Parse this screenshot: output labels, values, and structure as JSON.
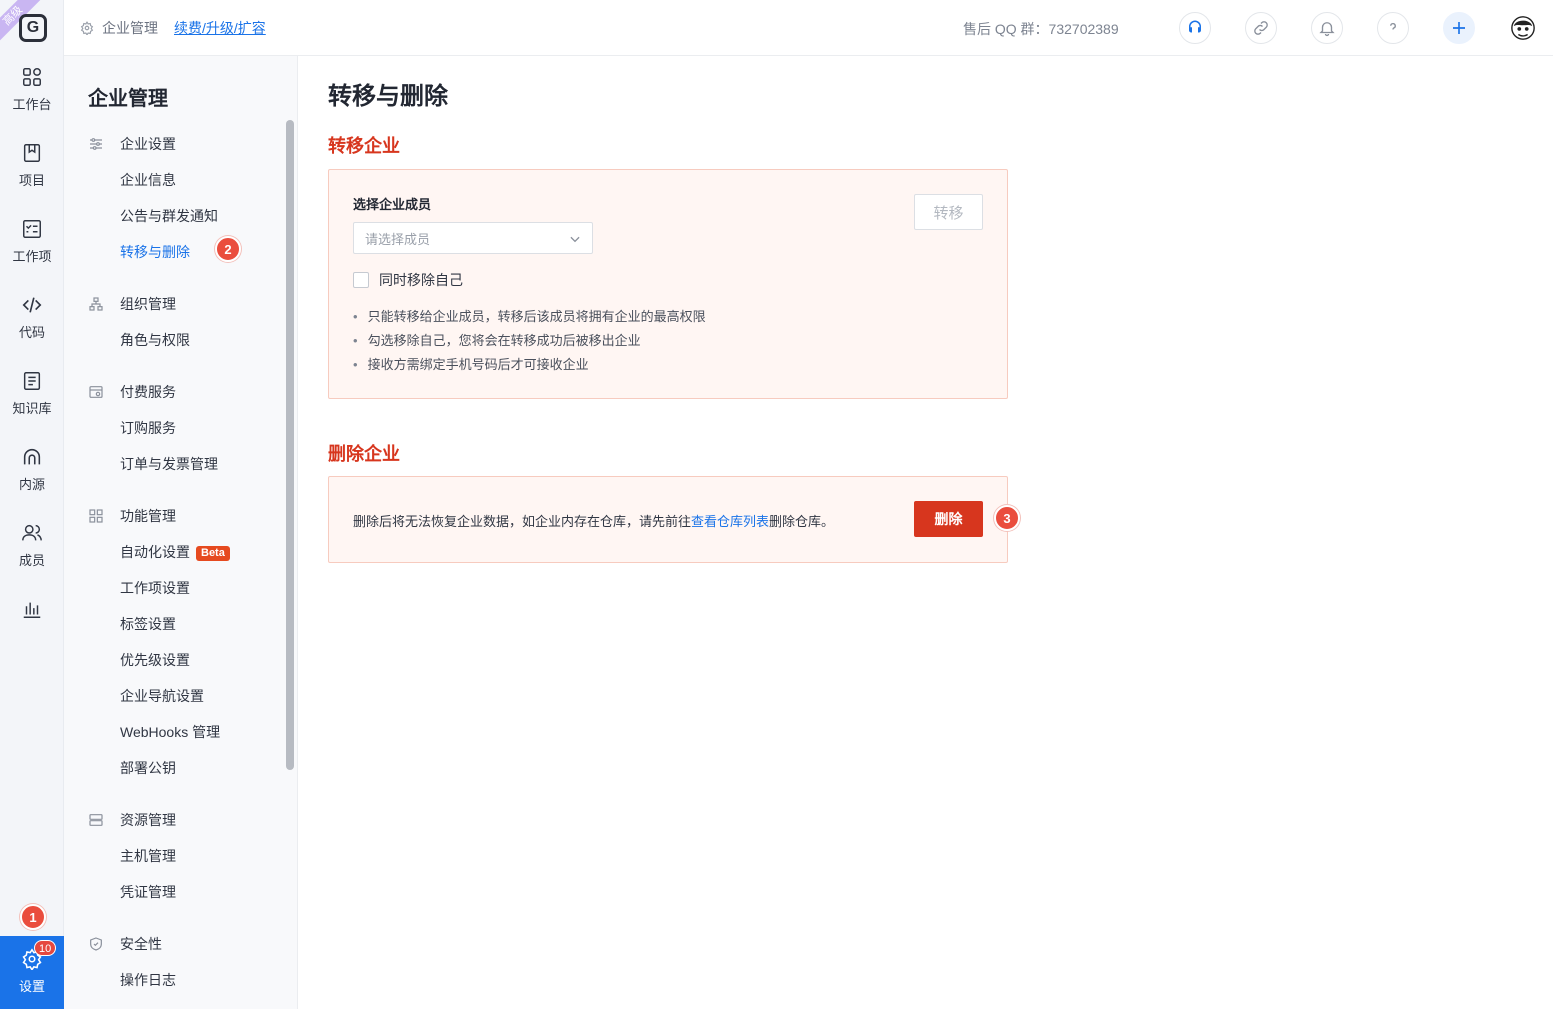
{
  "rail": {
    "ribbon": "高级",
    "logo": "G",
    "items": [
      {
        "label": "工作台",
        "icon": "grid-icon"
      },
      {
        "label": "项目",
        "icon": "book-icon"
      },
      {
        "label": "工作项",
        "icon": "checklist-icon"
      },
      {
        "label": "代码",
        "icon": "code-icon"
      },
      {
        "label": "知识库",
        "icon": "document-icon"
      },
      {
        "label": "内源",
        "icon": "source-icon"
      },
      {
        "label": "成员",
        "icon": "members-icon"
      },
      {
        "label": "",
        "icon": "bar-chart-icon"
      }
    ],
    "settings": {
      "label": "设置",
      "badge": "10"
    }
  },
  "steps": {
    "one": "1",
    "two": "2",
    "three": "3"
  },
  "header": {
    "breadcrumb": "企业管理",
    "renew_link": "续费/升级/扩容",
    "support": "售后 QQ 群：732702389"
  },
  "sidebar": {
    "title": "企业管理",
    "groups": [
      {
        "label": "企业设置",
        "items": [
          "企业信息",
          "公告与群发通知",
          "转移与删除"
        ]
      },
      {
        "label": "组织管理",
        "items": [
          "角色与权限"
        ]
      },
      {
        "label": "付费服务",
        "items": [
          "订购服务",
          "订单与发票管理"
        ]
      },
      {
        "label": "功能管理",
        "items": [
          "自动化设置",
          "工作项设置",
          "标签设置",
          "优先级设置",
          "企业导航设置",
          "WebHooks 管理",
          "部署公钥"
        ]
      },
      {
        "label": "资源管理",
        "items": [
          "主机管理",
          "凭证管理"
        ]
      },
      {
        "label": "安全性",
        "items": [
          "操作日志"
        ]
      }
    ],
    "beta": "Beta"
  },
  "main": {
    "title": "转移与删除",
    "transfer": {
      "heading": "转移企业",
      "field_label": "选择企业成员",
      "placeholder": "请选择成员",
      "checkbox": "同时移除自己",
      "button": "转移",
      "notes": [
        "只能转移给企业成员，转移后该成员将拥有企业的最高权限",
        "勾选移除自己，您将会在转移成功后被移出企业",
        "接收方需绑定手机号码后才可接收企业"
      ]
    },
    "delete": {
      "heading": "删除企业",
      "text_before": "删除后将无法恢复企业数据，如企业内存在仓库，请先前往",
      "link": "查看仓库列表",
      "text_after": "删除仓库。",
      "button": "删除"
    }
  }
}
